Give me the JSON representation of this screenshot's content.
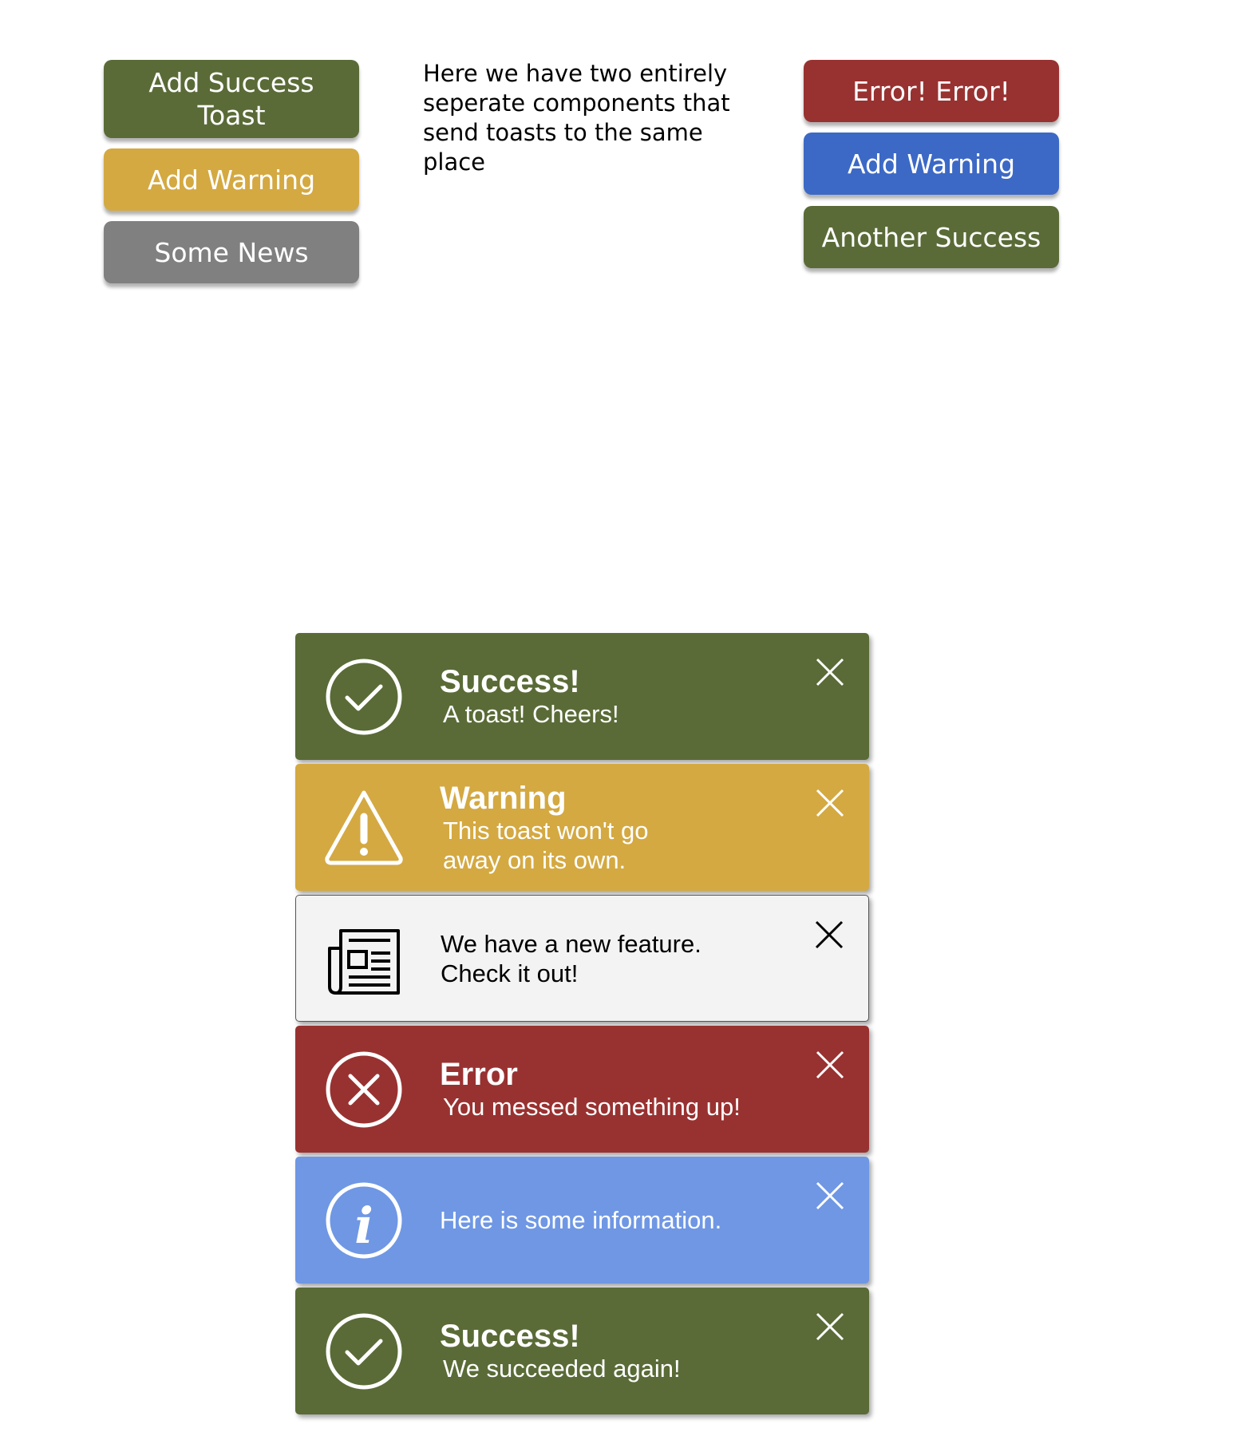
{
  "left_buttons": {
    "add_success_toast": "Add Success Toast",
    "add_warning": "Add Warning",
    "some_news": "Some News"
  },
  "note": "Here we have two entirely seperate components that send toasts to the same place",
  "right_buttons": {
    "error_error": "Error! Error!",
    "add_warning": "Add Warning",
    "another_success": "Another Success"
  },
  "toasts": [
    {
      "type": "success",
      "title": "Success!",
      "message": "A toast! Cheers!",
      "color": "#5a6b37",
      "icon": "check-circle-icon"
    },
    {
      "type": "warning",
      "title": "Warning",
      "message": "This toast won't go away on its own.",
      "color": "#d4a942",
      "icon": "warning-triangle-icon"
    },
    {
      "type": "news",
      "title": "",
      "message": "We have a new feature. Check it out!",
      "color": "#f3f3f3",
      "icon": "newspaper-icon"
    },
    {
      "type": "error",
      "title": "Error",
      "message": "You messed something up!",
      "color": "#983231",
      "icon": "x-circle-icon"
    },
    {
      "type": "info",
      "title": "",
      "message": "Here is some information.",
      "color": "#6f97e4",
      "icon": "info-circle-icon"
    },
    {
      "type": "success",
      "title": "Success!",
      "message": "We succeeded again!",
      "color": "#5a6b37",
      "icon": "check-circle-icon"
    }
  ],
  "colors": {
    "green": "#5a6b37",
    "yellow": "#d4a942",
    "grey": "#808080",
    "red": "#983231",
    "blue": "#3c69c5",
    "info": "#6f97e4"
  }
}
